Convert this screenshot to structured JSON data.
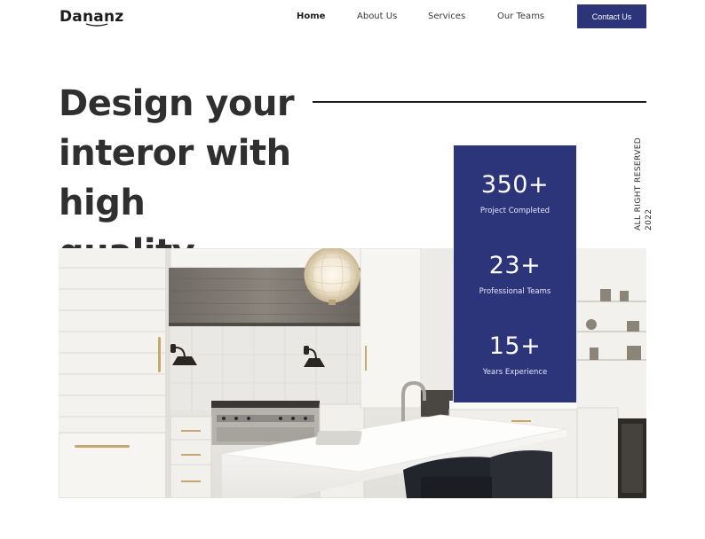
{
  "header": {
    "logo": "Dananz",
    "nav": {
      "home": "Home",
      "about": "About Us",
      "services": "Services",
      "teams": "Our Teams"
    },
    "contact_label": "Contact Us"
  },
  "hero": {
    "title_line1": "Design your",
    "title_line2": "interor with high",
    "title_line3": "quality.",
    "side_text_year": "2022",
    "side_text_rights": "ALL RIGHT RESERVED"
  },
  "stats": [
    {
      "value": "350+",
      "label": "Project Completed"
    },
    {
      "value": "23+",
      "label": "Professional Teams"
    },
    {
      "value": "15+",
      "label": "Years Experience"
    }
  ],
  "colors": {
    "accent": "#2c347a",
    "text": "#2f2f2f",
    "background": "#ffffff"
  },
  "icons": {
    "hero_image": "kitchen-photo"
  }
}
